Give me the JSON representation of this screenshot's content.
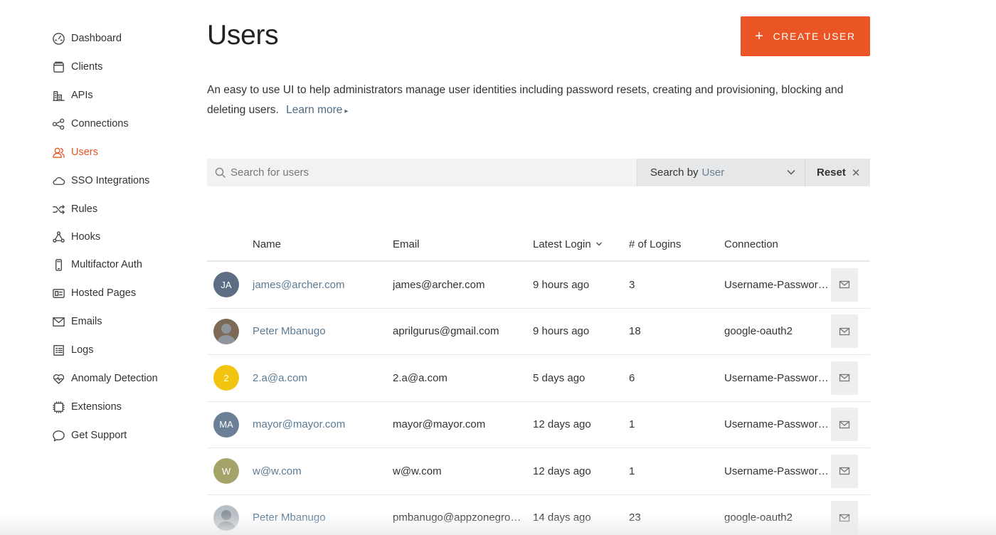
{
  "sidebar": {
    "items": [
      {
        "label": "Dashboard",
        "icon": "dashboard-icon",
        "active": false
      },
      {
        "label": "Clients",
        "icon": "clients-icon",
        "active": false
      },
      {
        "label": "APIs",
        "icon": "apis-icon",
        "active": false
      },
      {
        "label": "Connections",
        "icon": "connections-icon",
        "active": false
      },
      {
        "label": "Users",
        "icon": "users-icon",
        "active": true
      },
      {
        "label": "SSO Integrations",
        "icon": "cloud-icon",
        "active": false
      },
      {
        "label": "Rules",
        "icon": "shuffle-icon",
        "active": false
      },
      {
        "label": "Hooks",
        "icon": "hooks-icon",
        "active": false
      },
      {
        "label": "Multifactor Auth",
        "icon": "phone-icon",
        "active": false
      },
      {
        "label": "Hosted Pages",
        "icon": "hosted-pages-icon",
        "active": false
      },
      {
        "label": "Emails",
        "icon": "envelope-icon",
        "active": false
      },
      {
        "label": "Logs",
        "icon": "logs-icon",
        "active": false
      },
      {
        "label": "Anomaly Detection",
        "icon": "heart-pulse-icon",
        "active": false
      },
      {
        "label": "Extensions",
        "icon": "chip-icon",
        "active": false
      },
      {
        "label": "Get Support",
        "icon": "chat-bubble-icon",
        "active": false
      }
    ]
  },
  "header": {
    "title": "Users",
    "create_button": "CREATE USER",
    "plus": "+",
    "description": "An easy to use UI to help administrators manage user identities including password resets, creating and provisioning, blocking and deleting users.",
    "learn_more": "Learn more",
    "learn_more_arrow": "▸"
  },
  "search": {
    "placeholder": "Search for users",
    "search_by_label": "Search by",
    "search_by_value": "User",
    "reset_label": "Reset",
    "reset_x": "✕"
  },
  "table": {
    "columns": [
      "Name",
      "Email",
      "Latest Login",
      "# of Logins",
      "Connection"
    ],
    "rows": [
      {
        "initials": "JA",
        "avatar_color": "#5d6d84",
        "name": "james@archer.com",
        "email": "james@archer.com",
        "latest_login": "9 hours ago",
        "logins": "3",
        "connection": "Username-Password-Authentication"
      },
      {
        "initials": "",
        "avatar_color": "#7c6a56",
        "name": "Peter Mbanugo",
        "email": "aprilgurus@gmail.com",
        "latest_login": "9 hours ago",
        "logins": "18",
        "connection": "google-oauth2"
      },
      {
        "initials": "2",
        "avatar_color": "#f2c40f",
        "name": "2.a@a.com",
        "email": "2.a@a.com",
        "latest_login": "5 days ago",
        "logins": "6",
        "connection": "Username-Password-Authentication"
      },
      {
        "initials": "MA",
        "avatar_color": "#6b7f96",
        "name": "mayor@mayor.com",
        "email": "mayor@mayor.com",
        "latest_login": "12 days ago",
        "logins": "1",
        "connection": "Username-Password-Authentication"
      },
      {
        "initials": "W",
        "avatar_color": "#a3a36a",
        "name": "w@w.com",
        "email": "w@w.com",
        "latest_login": "12 days ago",
        "logins": "1",
        "connection": "Username-Password-Authentication"
      },
      {
        "initials": "",
        "avatar_color": "#b9bfc6",
        "name": "Peter Mbanugo",
        "email": "pmbanugo@appzonegroup.com",
        "latest_login": "14 days ago",
        "logins": "23",
        "connection": "google-oauth2"
      }
    ]
  },
  "colors": {
    "accent": "#eb5424",
    "link": "#5a7a94"
  }
}
